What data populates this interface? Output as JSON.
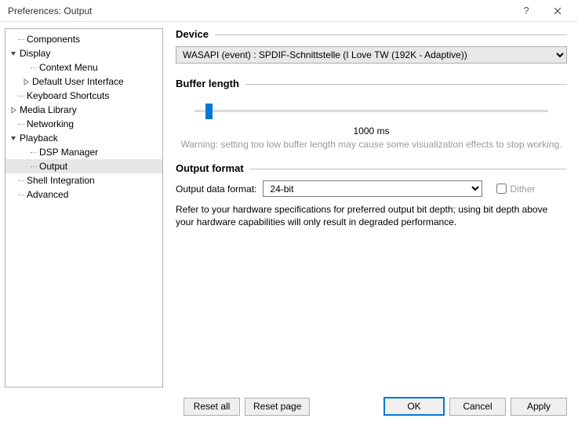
{
  "window": {
    "title": "Preferences: Output"
  },
  "sidebar": {
    "items": {
      "components": "Components",
      "display": "Display",
      "context_menu": "Context Menu",
      "default_ui": "Default User Interface",
      "keyboard_shortcuts": "Keyboard Shortcuts",
      "media_library": "Media Library",
      "networking": "Networking",
      "playback": "Playback",
      "dsp_manager": "DSP Manager",
      "output": "Output",
      "shell_integration": "Shell Integration",
      "advanced": "Advanced"
    }
  },
  "device": {
    "section_title": "Device",
    "selected": "WASAPI (event) : SPDIF-Schnittstelle (I Love TW (192K - Adaptive))"
  },
  "buffer": {
    "section_title": "Buffer length",
    "value_label": "1000 ms",
    "value_ms": 1000,
    "warning": "Warning: setting too low buffer length may cause some visualization effects to stop working."
  },
  "format": {
    "section_title": "Output format",
    "label": "Output data format:",
    "selected": "24-bit",
    "dither_label": "Dither",
    "dither_checked": false,
    "note": "Refer to your hardware specifications for preferred output bit depth; using bit depth above your hardware capabilities will only result in degraded performance."
  },
  "buttons": {
    "reset_all": "Reset all",
    "reset_page": "Reset page",
    "ok": "OK",
    "cancel": "Cancel",
    "apply": "Apply"
  }
}
